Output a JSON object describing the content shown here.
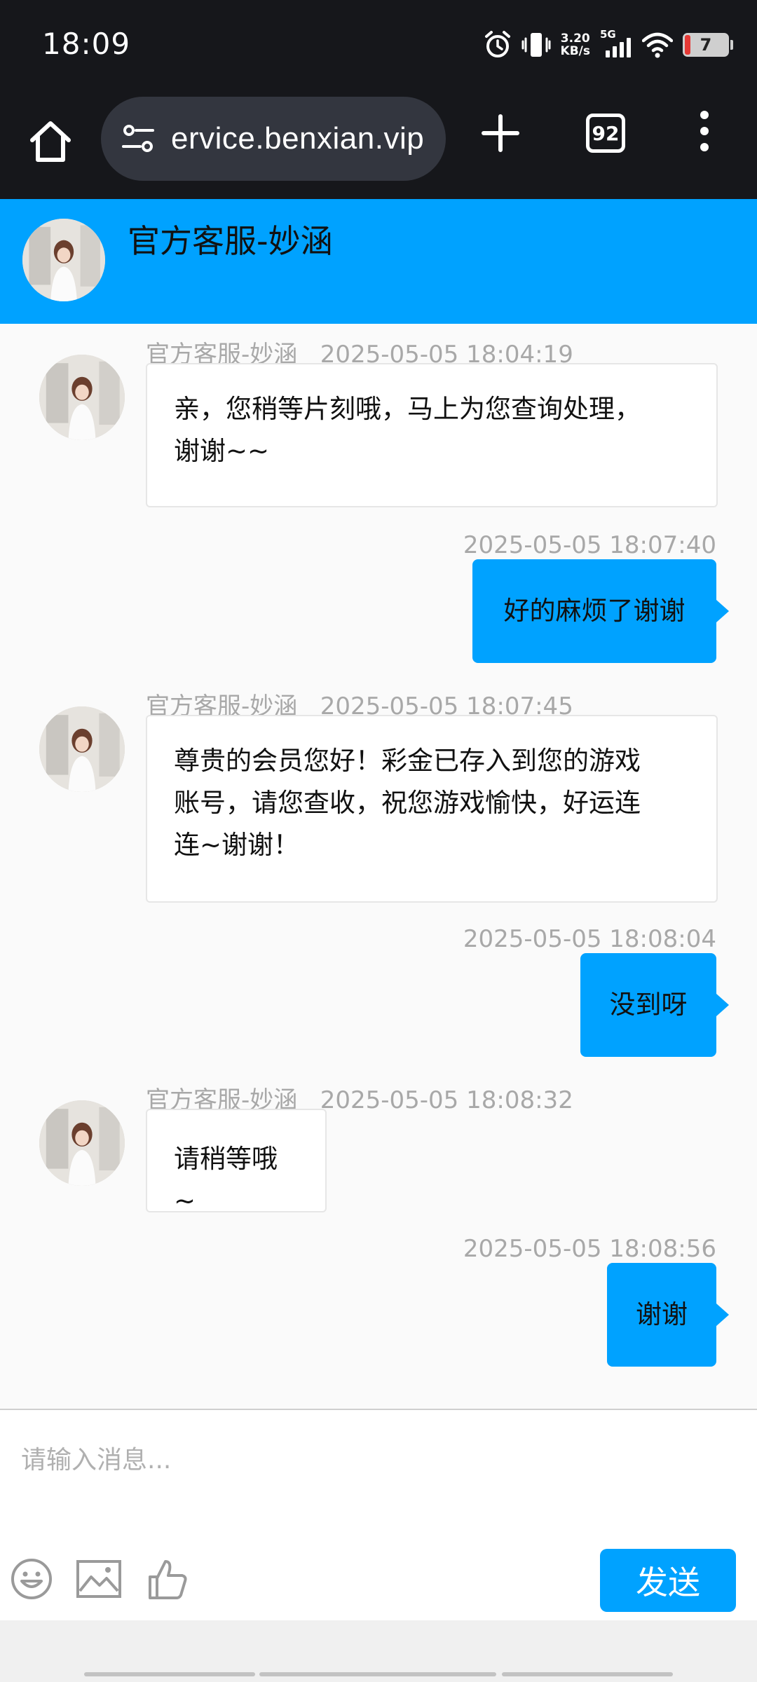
{
  "status_bar": {
    "time": "18:09",
    "net_speed_value": "3.20",
    "net_speed_unit": "KB/s",
    "network": "5G",
    "battery": "7",
    "icons": [
      "alarm-icon",
      "vibrate-icon",
      "signal-icon",
      "wifi-icon",
      "battery-icon"
    ]
  },
  "browser": {
    "url": "ervice.benxian.vip",
    "tab_count": "92",
    "icons": [
      "home-icon",
      "site-settings-icon",
      "new-tab-icon",
      "tabs-icon",
      "more-menu-icon"
    ]
  },
  "chat_header": {
    "agent_name": "官方客服-妙涵"
  },
  "messages": [
    {
      "direction": "in",
      "sender": "官方客服-妙涵",
      "time": "2025-05-05 18:04:19",
      "lines": [
        "亲，您稍等片刻哦，马上为您查询处理，",
        "谢谢~~"
      ]
    },
    {
      "direction": "out",
      "time": "2025-05-05 18:07:40",
      "text": "好的麻烦了谢谢"
    },
    {
      "direction": "in",
      "sender": "官方客服-妙涵",
      "time": "2025-05-05 18:07:45",
      "lines": [
        "尊贵的会员您好！彩金已存入到您的游戏",
        "账号，请您查收，祝您游戏愉快，好运连",
        "连~谢谢！"
      ]
    },
    {
      "direction": "out",
      "time": "2025-05-05 18:08:04",
      "text": "没到呀"
    },
    {
      "direction": "in",
      "sender": "官方客服-妙涵",
      "time": "2025-05-05 18:08:32",
      "lines": [
        "请稍等哦~"
      ]
    },
    {
      "direction": "out",
      "time": "2025-05-05 18:08:56",
      "text": "谢谢"
    }
  ],
  "composer": {
    "placeholder": "请输入消息...",
    "send_label": "发送",
    "tools": [
      "emoji-icon",
      "image-icon",
      "thumbs-up-icon"
    ]
  },
  "colors": {
    "accent": "#00a2ff",
    "status_bar_bg": "#16171b",
    "url_pill_bg": "#33363f",
    "meta_text": "#a8a8a8"
  }
}
